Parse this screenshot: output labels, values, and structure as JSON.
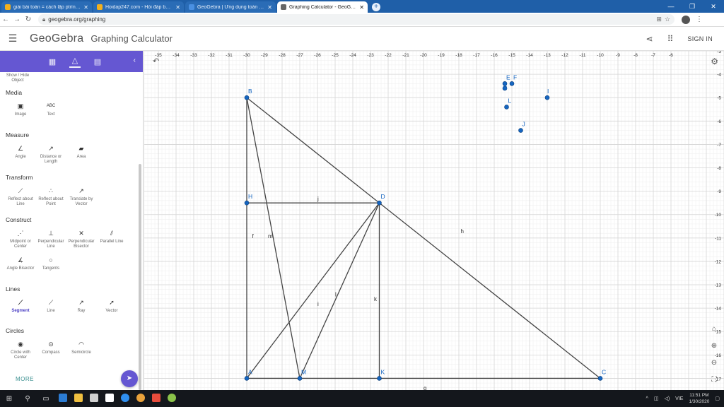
{
  "browser": {
    "tabs": [
      {
        "title": "giải bài toán = cách lập ptrình k:",
        "fav": "#f2b01e",
        "active": false
      },
      {
        "title": "Hoidap247.com - Hỏi đáp bài tập",
        "fav": "#f2b01e",
        "active": false
      },
      {
        "title": "GeoGebra | Ứng dụng toán học",
        "fav": "#4a90e2",
        "active": false
      },
      {
        "title": "Graphing Calculator - GeoGebra",
        "fav": "#666666",
        "active": true
      }
    ],
    "url": "geogebra.org/graphing",
    "new_tab": "+"
  },
  "header": {
    "logo": "GeoGebra",
    "app_title": "Graphing Calculator",
    "signin": "SIGN IN"
  },
  "panel": {
    "show_hide": "Show / Hide Object",
    "more": "MORE",
    "sections": [
      {
        "title": "Media",
        "tools": [
          {
            "label": "Image",
            "icon": "image-icon"
          },
          {
            "label": "Text",
            "icon": "text-icon",
            "glyph": "ABC"
          }
        ]
      },
      {
        "title": "Measure",
        "tools": [
          {
            "label": "Angle",
            "icon": "angle-icon"
          },
          {
            "label": "Distance or Length",
            "icon": "distance-icon"
          },
          {
            "label": "Area",
            "icon": "area-icon"
          }
        ]
      },
      {
        "title": "Transform",
        "tools": [
          {
            "label": "Reflect about Line",
            "icon": "reflect-line-icon"
          },
          {
            "label": "Reflect about Point",
            "icon": "reflect-point-icon"
          },
          {
            "label": "Translate by Vector",
            "icon": "translate-icon"
          }
        ]
      },
      {
        "title": "Construct",
        "tools": [
          {
            "label": "Midpoint or Center",
            "icon": "midpoint-icon"
          },
          {
            "label": "Perpendicular Line",
            "icon": "perpendicular-icon"
          },
          {
            "label": "Perpendicular Bisector",
            "icon": "bisector-icon"
          },
          {
            "label": "Parallel Line",
            "icon": "parallel-icon"
          },
          {
            "label": "Angle Bisector",
            "icon": "angle-bisector-icon"
          },
          {
            "label": "Tangents",
            "icon": "tangents-icon"
          }
        ]
      },
      {
        "title": "Lines",
        "tools": [
          {
            "label": "Segment",
            "icon": "segment-icon",
            "selected": true
          },
          {
            "label": "Line",
            "icon": "line-icon"
          },
          {
            "label": "Ray",
            "icon": "ray-icon"
          },
          {
            "label": "Vector",
            "icon": "vector-icon"
          }
        ]
      },
      {
        "title": "Circles",
        "tools": [
          {
            "label": "Circle with Center",
            "icon": "circle-center-icon"
          },
          {
            "label": "Compass",
            "icon": "compass-icon"
          },
          {
            "label": "Semicircle",
            "icon": "semicircle-icon"
          }
        ]
      }
    ]
  },
  "graph": {
    "x_range": [
      -35.8,
      -3
    ],
    "y_range": [
      -17.5,
      -3
    ],
    "x_ticks": [
      -35,
      -34,
      -33,
      -32,
      -31,
      -30,
      -29,
      -28,
      -27,
      -26,
      -25,
      -24,
      -23,
      -22,
      -21,
      -20,
      -19,
      -18,
      -17,
      -16,
      -15,
      -14,
      -13,
      -12,
      -11,
      -10,
      -9,
      -8,
      -7,
      -6
    ],
    "y_ticks": [
      -4,
      -5,
      -6,
      -7,
      -8,
      -9,
      -10,
      -11,
      -12,
      -13,
      -14,
      -15,
      -16
    ],
    "y_ticks_partial": [
      "-3",
      "-17"
    ],
    "point_color": "#1565c0",
    "points": [
      {
        "name": "B",
        "x": -30,
        "y": -5
      },
      {
        "name": "H",
        "x": -30,
        "y": -9.5
      },
      {
        "name": "D",
        "x": -22.5,
        "y": -9.5
      },
      {
        "name": "A",
        "x": -30,
        "y": -17
      },
      {
        "name": "M",
        "x": -27,
        "y": -17
      },
      {
        "name": "K",
        "x": -22.5,
        "y": -17
      },
      {
        "name": "C",
        "x": -10,
        "y": -17
      },
      {
        "name": "E",
        "x": -15.4,
        "y": -4.4
      },
      {
        "name": "F",
        "x": -15,
        "y": -4.4
      },
      {
        "name": "G",
        "x": -15.4,
        "y": -4.6
      },
      {
        "name": "I",
        "x": -13,
        "y": -5
      },
      {
        "name": "L",
        "x": -15.3,
        "y": -5.4
      },
      {
        "name": "J",
        "x": -14.5,
        "y": -6.4
      }
    ],
    "segments": [
      {
        "name": "f",
        "from": "B",
        "to": "A"
      },
      {
        "name": "h",
        "from": "B",
        "to": "C"
      },
      {
        "name": "g",
        "from": "A",
        "to": "C"
      },
      {
        "name": "j",
        "from": "H",
        "to": "D"
      },
      {
        "name": "k",
        "from": "D",
        "to": "K"
      },
      {
        "name": "i",
        "from": "A",
        "to": "D"
      },
      {
        "name": "l",
        "from": "M",
        "to": "D"
      },
      {
        "name": "m",
        "from": "B",
        "to": "M"
      }
    ],
    "segment_labels": [
      {
        "name": "j",
        "x": -26,
        "y": -9.4
      },
      {
        "name": "h",
        "x": -17.9,
        "y": -10.8
      },
      {
        "name": "f",
        "x": -29.7,
        "y": -11
      },
      {
        "name": "m",
        "x": -28.8,
        "y": -11
      },
      {
        "name": "l",
        "x": -25,
        "y": -13.5
      },
      {
        "name": "i",
        "x": -26,
        "y": -13.9
      },
      {
        "name": "k",
        "x": -22.8,
        "y": -13.7
      },
      {
        "name": "g",
        "x": -20,
        "y": -17.5
      }
    ]
  },
  "taskbar": {
    "time": "11:51 PM",
    "date": "1/30/2020",
    "lang": "VIE"
  }
}
